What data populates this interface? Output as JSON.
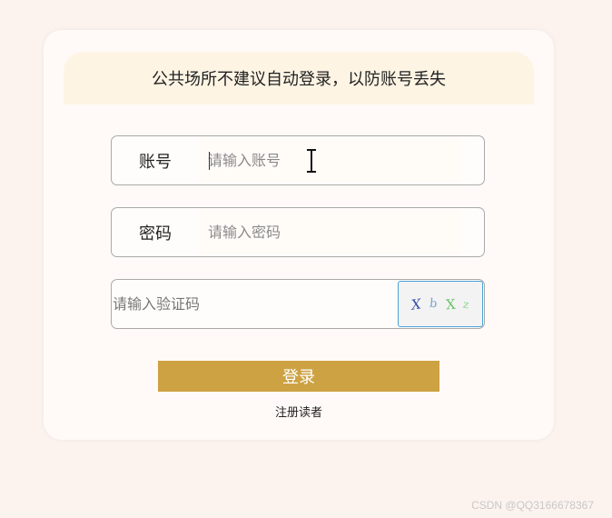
{
  "banner": {
    "text": "公共场所不建议自动登录，以防账号丢失"
  },
  "form": {
    "account": {
      "label": "账号",
      "placeholder": "请输入账号"
    },
    "password": {
      "label": "密码",
      "placeholder": "请输入密码"
    },
    "captcha": {
      "placeholder": "请输入验证码",
      "chars": [
        "X",
        "b",
        "X",
        "z"
      ]
    },
    "login_label": "登录",
    "register_label": "注册读者"
  },
  "watermark": "CSDN @QQ3166678367",
  "colors": {
    "page_background": "#fcf3ef",
    "banner_background": "#fdf4e4",
    "button": "#cda243",
    "captcha_border": "#4aa3d8"
  },
  "icons": {
    "cursor": "text-ibeam-cursor-icon"
  }
}
